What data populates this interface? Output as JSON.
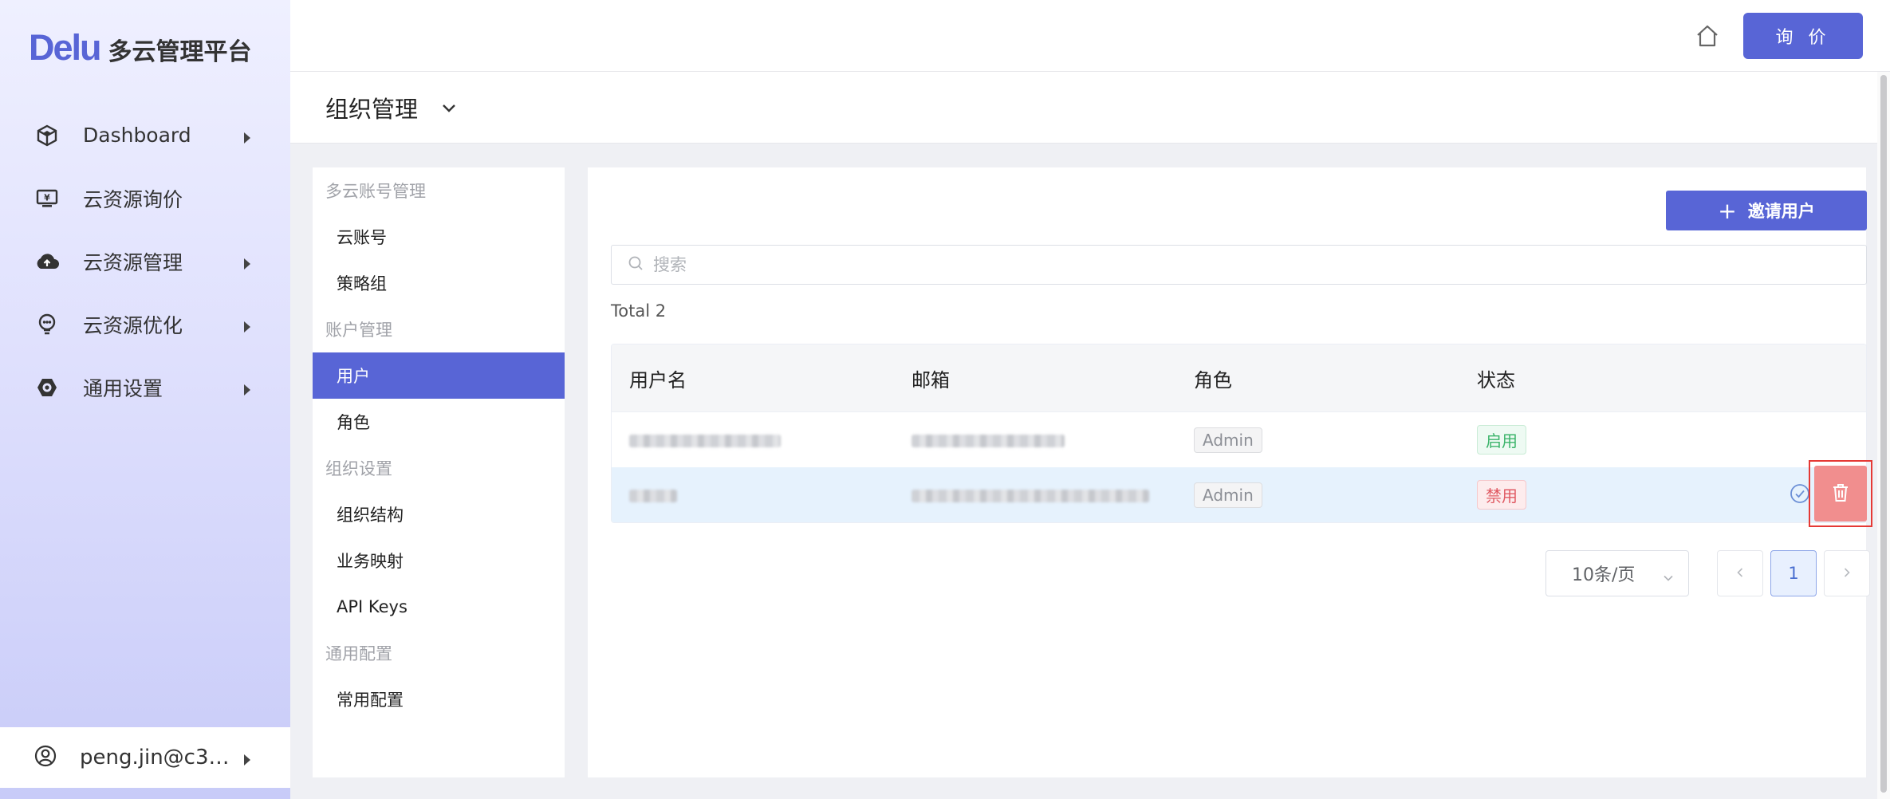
{
  "brand": {
    "logo": "Delu",
    "name": "多云管理平台"
  },
  "sidebar": {
    "items": [
      {
        "label": "Dashboard",
        "icon": "cube-icon",
        "has_arrow": true
      },
      {
        "label": "云资源询价",
        "icon": "monitor-yen-icon",
        "has_arrow": false
      },
      {
        "label": "云资源管理",
        "icon": "cloud-upload-icon",
        "has_arrow": true
      },
      {
        "label": "云资源优化",
        "icon": "bulb-icon",
        "has_arrow": true
      },
      {
        "label": "通用设置",
        "icon": "hex-gear-icon",
        "has_arrow": true
      }
    ],
    "user": "peng.jin@c3…"
  },
  "header": {
    "quote_label": "询 价",
    "page_title": "组织管理"
  },
  "subnav": {
    "groups": [
      {
        "title": "多云账号管理",
        "items": [
          "云账号",
          "策略组"
        ]
      },
      {
        "title": "账户管理",
        "items": [
          "用户",
          "角色"
        ]
      },
      {
        "title": "组织设置",
        "items": [
          "组织结构",
          "业务映射",
          "API Keys"
        ]
      },
      {
        "title": "通用配置",
        "items": [
          "常用配置"
        ]
      }
    ],
    "active": "用户"
  },
  "main": {
    "invite_label": "邀请用户",
    "search_placeholder": "搜索",
    "total_text": "Total 2",
    "columns": [
      "用户名",
      "邮箱",
      "角色",
      "状态"
    ],
    "rows": [
      {
        "role": "Admin",
        "status": "启用",
        "status_type": "on"
      },
      {
        "role": "Admin",
        "status": "禁用",
        "status_type": "off"
      }
    ],
    "page_size": "10条/页",
    "current_page": "1"
  },
  "colors": {
    "accent": "#5865d6",
    "danger": "#f18e8e",
    "highlight": "#e53935"
  }
}
